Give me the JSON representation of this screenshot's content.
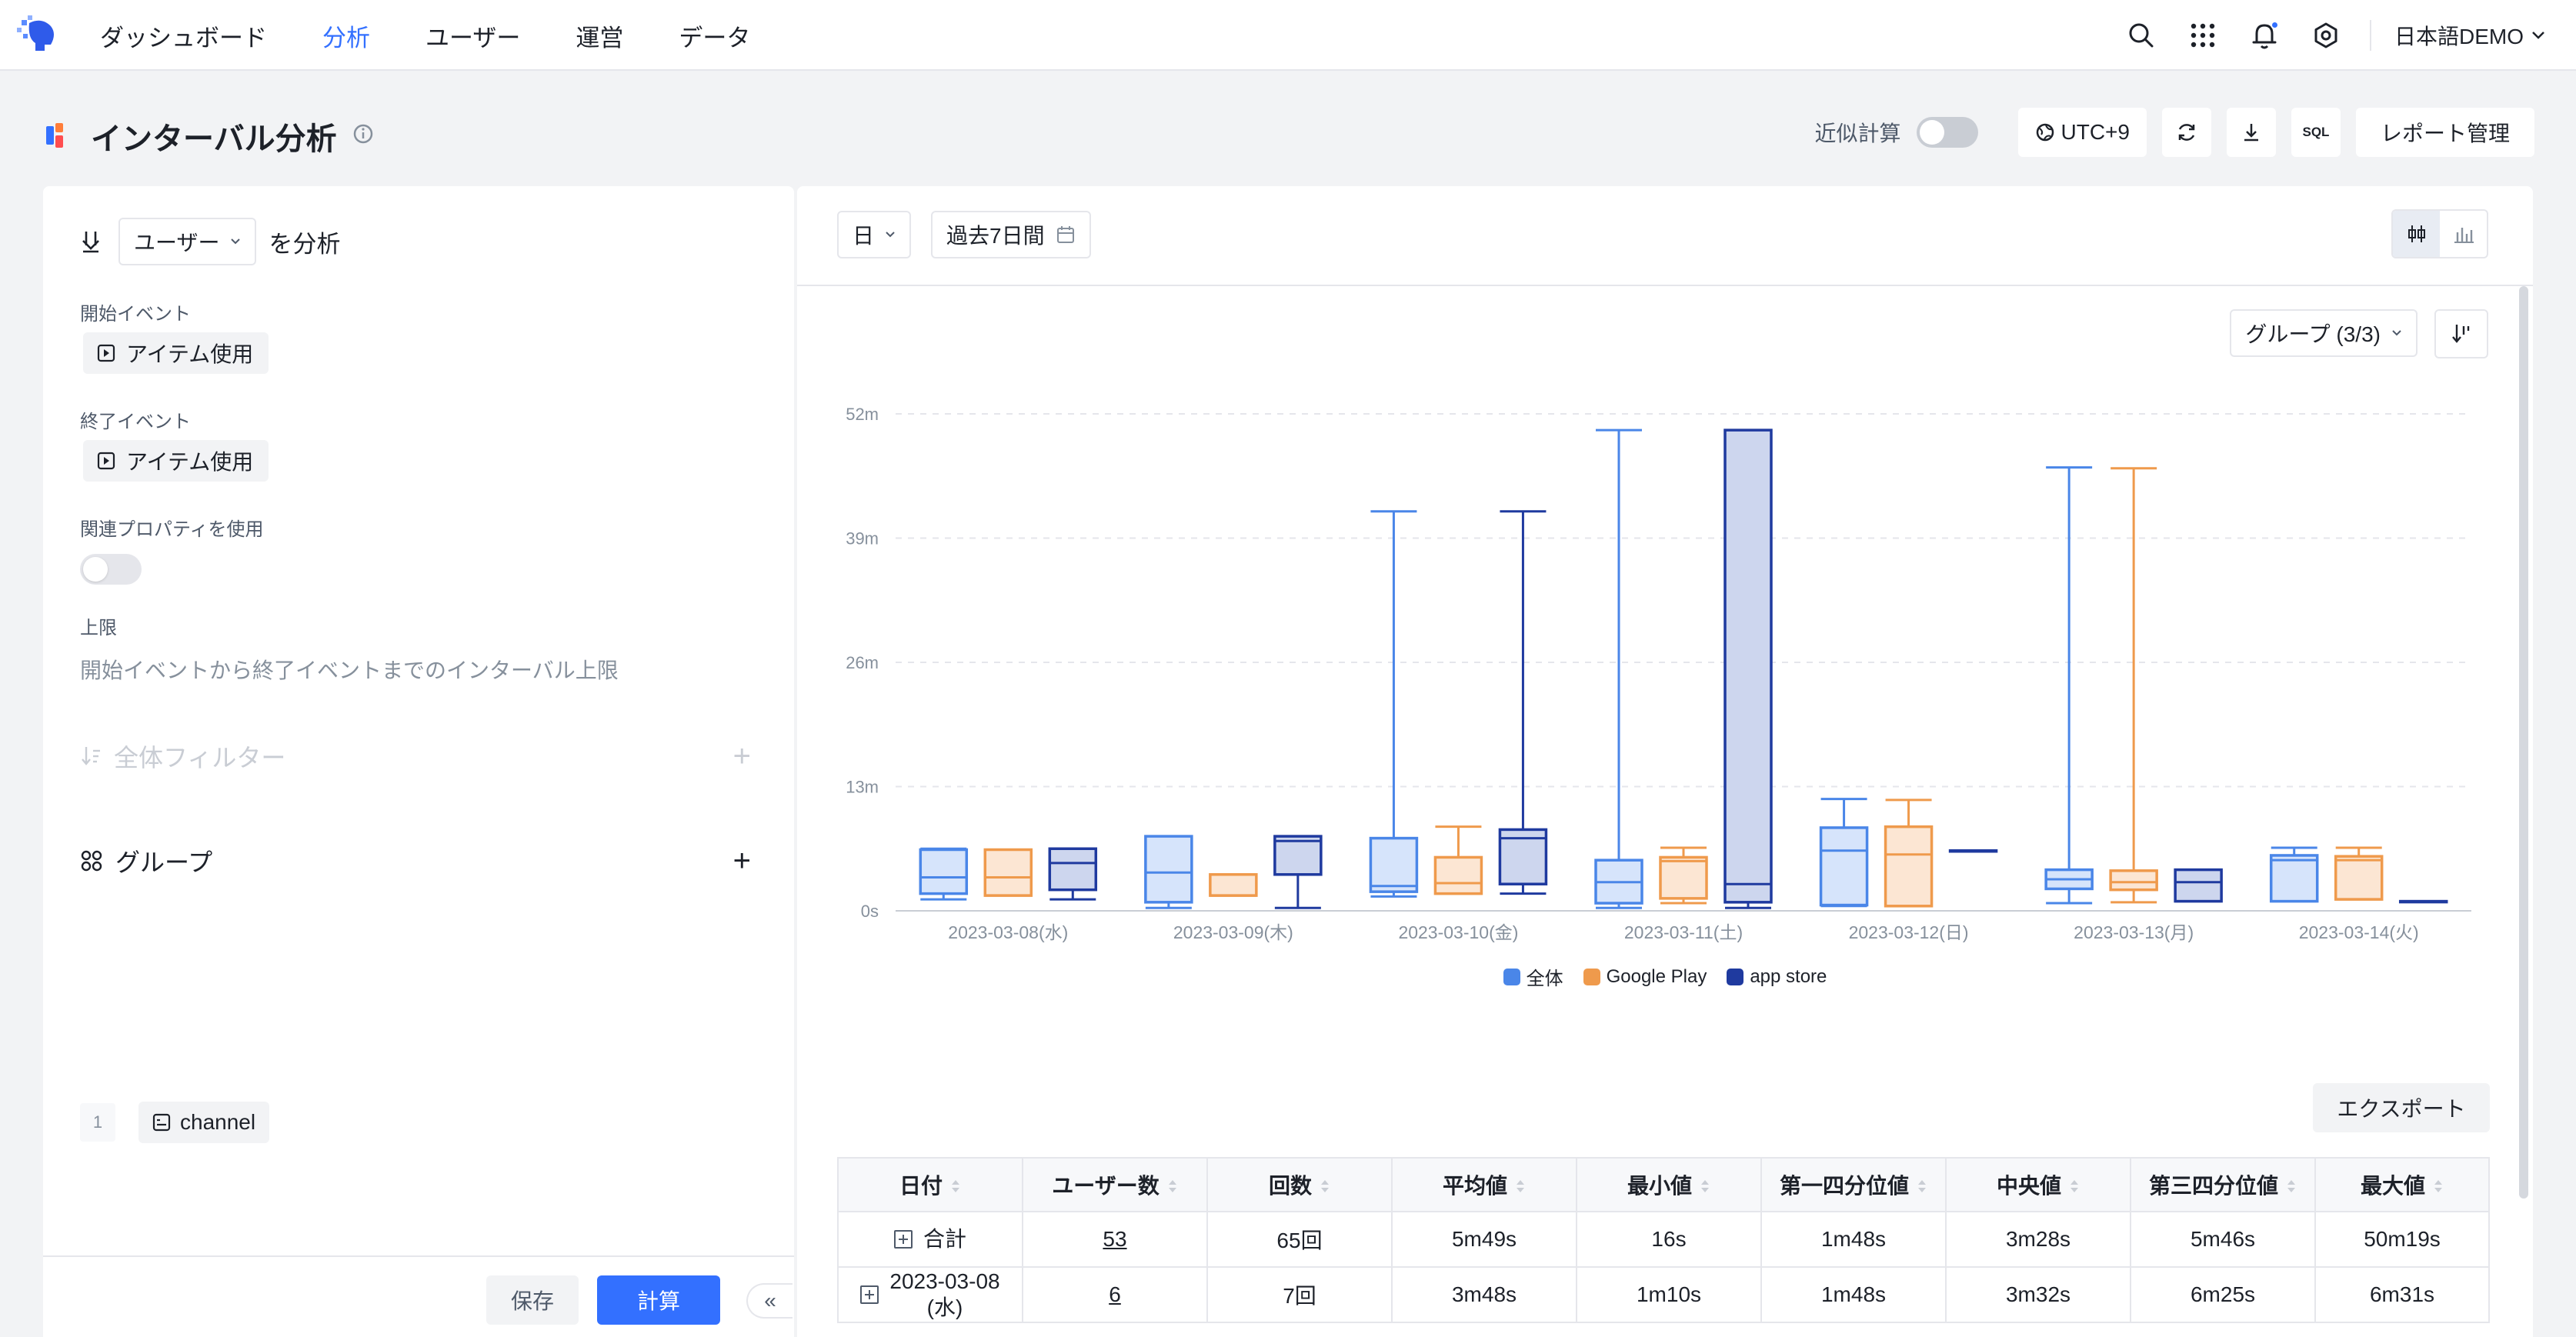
{
  "nav": {
    "items": [
      "ダッシュボード",
      "分析",
      "ユーザー",
      "運営",
      "データ"
    ],
    "active_index": 1,
    "lang": "日本語DEMO"
  },
  "page": {
    "title": "インターバル分析",
    "approx_label": "近似計算",
    "tz_label": "UTC+9",
    "sql_label": "SQL",
    "report_label": "レポート管理"
  },
  "left": {
    "analyze_select": "ユーザー",
    "analyze_suffix": "を分析",
    "start_label": "開始イベント",
    "start_event": "アイテム使用",
    "end_label": "終了イベント",
    "end_event": "アイテム使用",
    "related_label": "関連プロパティを使用",
    "limit_label": "上限",
    "limit_placeholder": "開始イベントから終了イベントまでのインターバル上限",
    "filter_label": "全体フィルター",
    "group_label": "グループ",
    "group_item_index": "1",
    "group_item": "channel",
    "save": "保存",
    "calc": "計算",
    "collapse": "«"
  },
  "right": {
    "granularity": "日",
    "range": "過去7日間",
    "group_select": "グループ (3/3)",
    "export": "エクスポート"
  },
  "colors": {
    "all": "#4a86e8",
    "google": "#ef9a4c",
    "appstore": "#1f3a9f",
    "accent": "#3370ff"
  },
  "chart_data": {
    "type": "boxplot",
    "y_unit": "minutes",
    "ylim": [
      0,
      52
    ],
    "yticks": [
      "0s",
      "13m",
      "26m",
      "39m",
      "52m"
    ],
    "categories": [
      "2023-03-08(水)",
      "2023-03-09(木)",
      "2023-03-10(金)",
      "2023-03-11(土)",
      "2023-03-12(日)",
      "2023-03-13(月)",
      "2023-03-14(火)"
    ],
    "series": [
      {
        "name": "全体",
        "values": [
          [
            1.2,
            1.8,
            3.5,
            6.4,
            6.5
          ],
          [
            0.3,
            0.9,
            4.0,
            7.8,
            7.8
          ],
          [
            1.5,
            2.0,
            2.6,
            7.6,
            41.8
          ],
          [
            0.3,
            0.8,
            3.0,
            5.3,
            50.3
          ],
          [
            0.5,
            0.6,
            6.3,
            8.7,
            11.7
          ],
          [
            0.8,
            2.3,
            3.3,
            4.3,
            46.4
          ],
          [
            1.0,
            1.0,
            5.3,
            5.8,
            6.6
          ]
        ]
      },
      {
        "name": "Google Play",
        "values": [
          [
            1.6,
            1.6,
            3.5,
            6.4,
            6.4
          ],
          [
            1.6,
            1.6,
            1.6,
            3.8,
            3.8
          ],
          [
            1.8,
            1.8,
            2.9,
            5.6,
            8.8
          ],
          [
            0.8,
            1.3,
            5.2,
            5.6,
            6.6
          ],
          [
            0.5,
            0.5,
            5.9,
            8.8,
            11.6
          ],
          [
            0.9,
            2.2,
            3.0,
            4.2,
            46.3
          ],
          [
            1.2,
            1.2,
            5.3,
            5.7,
            6.6
          ]
        ]
      },
      {
        "name": "app store",
        "values": [
          [
            1.2,
            2.2,
            5.0,
            6.5,
            6.5
          ],
          [
            0.3,
            3.8,
            7.3,
            7.8,
            7.8
          ],
          [
            1.8,
            2.8,
            7.6,
            8.5,
            41.8
          ],
          [
            0.3,
            0.9,
            2.8,
            50.3,
            50.3
          ],
          [
            6.3,
            6.3,
            6.3,
            6.3,
            6.3
          ],
          [
            1.0,
            1.0,
            3.0,
            4.3,
            4.3
          ],
          [
            1.0,
            1.0,
            1.0,
            1.0,
            1.0
          ]
        ]
      }
    ]
  },
  "table": {
    "headers": [
      "日付",
      "ユーザー数",
      "回数",
      "平均値",
      "最小値",
      "第一四分位値",
      "中央値",
      "第三四分位値",
      "最大値"
    ],
    "rows": [
      {
        "date": "合計",
        "users": "53",
        "count": "65回",
        "avg": "5m49s",
        "min": "16s",
        "q1": "1m48s",
        "median": "3m28s",
        "q3": "5m46s",
        "max": "50m19s"
      },
      {
        "date": "2023-03-08",
        "date2": "(水)",
        "users": "6",
        "count": "7回",
        "avg": "3m48s",
        "min": "1m10s",
        "q1": "1m48s",
        "median": "3m32s",
        "q3": "6m25s",
        "max": "6m31s"
      }
    ]
  }
}
